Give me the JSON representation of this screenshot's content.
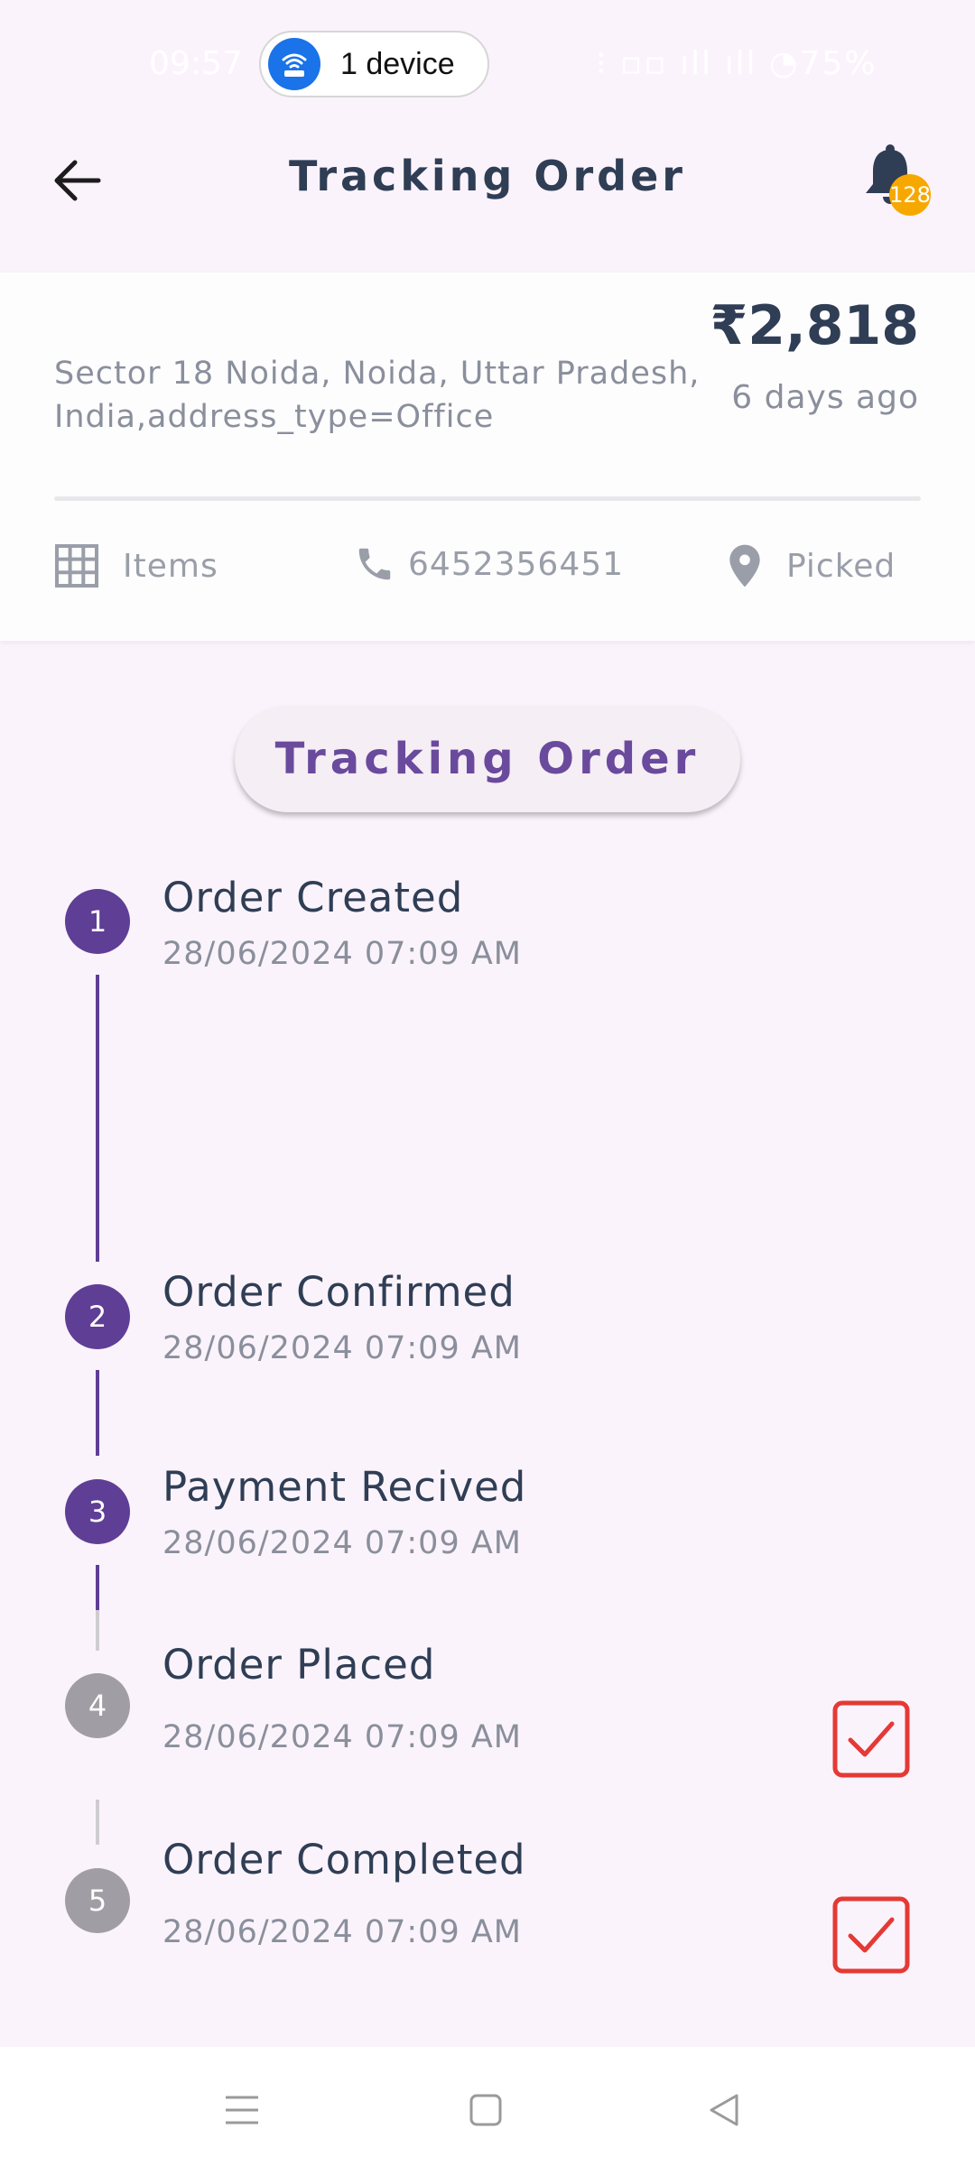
{
  "status_bar": {
    "time": "09:57",
    "indicators": "⁝ ▫▫ ıll ıll ◔75%",
    "device_pill": {
      "label": "1 device",
      "icon": "wifi-router-icon"
    }
  },
  "header": {
    "title": "Tracking Order",
    "back_icon": "arrow-left-icon",
    "bell_icon": "bell-icon",
    "notification_count": "128"
  },
  "summary": {
    "address": "Sector 18 Noida, Noida, Uttar Pradesh, India,address_type=Office",
    "price": "₹2,818",
    "time_ago": "6 days ago",
    "items_label": "Items",
    "phone": "6452356451",
    "status": "Picked"
  },
  "tracking_button": {
    "label": "Tracking Order"
  },
  "steps": [
    {
      "number": "1",
      "title": "Order Created",
      "date": "28/06/2024 07:09 AM",
      "done": true
    },
    {
      "number": "2",
      "title": "Order Confirmed",
      "date": "28/06/2024 07:09 AM",
      "done": true
    },
    {
      "number": "3",
      "title": "Payment Recived",
      "date": "28/06/2024 07:09 AM",
      "done": true
    },
    {
      "number": "4",
      "title": "Order Placed",
      "date": "28/06/2024 07:09 AM",
      "done": false,
      "checkbox": true
    },
    {
      "number": "5",
      "title": "Order Completed",
      "date": "28/06/2024 07:09 AM",
      "done": false,
      "checkbox": true
    }
  ],
  "colors": {
    "accent": "#5f3e96",
    "pending": "#a09da4",
    "badge": "#f7a800",
    "checkbox": "#e53935",
    "background": "#fbf3fb"
  }
}
